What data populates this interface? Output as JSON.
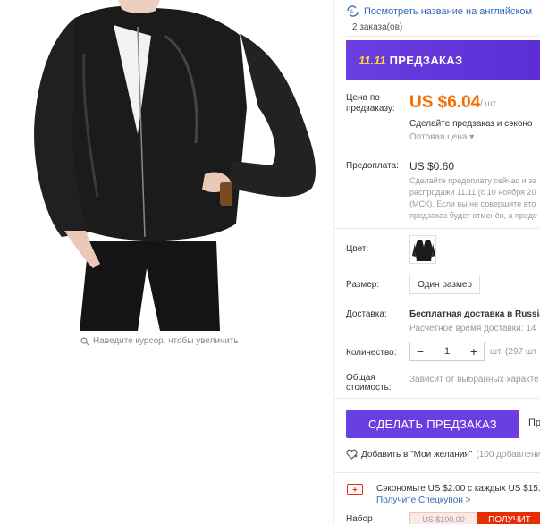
{
  "translate": {
    "label": "Посмотреть название на английском"
  },
  "orders": {
    "text": "2 заказа(ов)"
  },
  "banner": {
    "badge": "11.11",
    "text": "ПРЕДЗАКАЗ"
  },
  "price": {
    "label": "Цена по предзаказу:",
    "value": "US $6.04",
    "unit": "/ шт.",
    "note": "Сделайте предзаказ и сэконо",
    "wholesale": "Оптовая цена ▾"
  },
  "prepay": {
    "label": "Предоплата:",
    "value": "US $0.60",
    "desc_lines": [
      "Сделайте предоплату сейчас и за",
      "распродажи 11.11 (с 10 ноября 20",
      "(МСК). Если вы не совершите вто",
      "предзаказ будет отменён, а преде"
    ]
  },
  "color": {
    "label": "Цвет:"
  },
  "size": {
    "label": "Размер:",
    "option": "Один размер"
  },
  "shipping": {
    "label": "Доставка:",
    "value": "Бесплатная доставка в Russia",
    "time": "Расчётное время доставки: 14"
  },
  "quantity": {
    "label": "Количество:",
    "minus": "−",
    "value": "1",
    "plus": "+",
    "unit": "шт. (297 шт"
  },
  "total": {
    "label": "Общая стоимость:",
    "value": "Зависит от выбранных характе"
  },
  "actions": {
    "preorder": "СДЕЛАТЬ ПРЕДЗАКАЗ",
    "cut_text": "Пр"
  },
  "wishlist": {
    "label": "Добавить в \"Мои желания\"",
    "count": "(100 добавлени"
  },
  "coupon": {
    "text": "Сэкономьте US $2.00 с каждых US $15.",
    "link": "Получите Спецкупон >"
  },
  "bundle": {
    "label": "Набор",
    "old_price": "US $100.00",
    "button": "ПОЛУЧИТ"
  },
  "image": {
    "zoom_hint": "Наведите курсор, чтобы увеличить"
  },
  "colors": {
    "accent": "#6a3ee0",
    "price": "#f56c00",
    "link": "#2f6cb5",
    "red": "#e62e04"
  }
}
